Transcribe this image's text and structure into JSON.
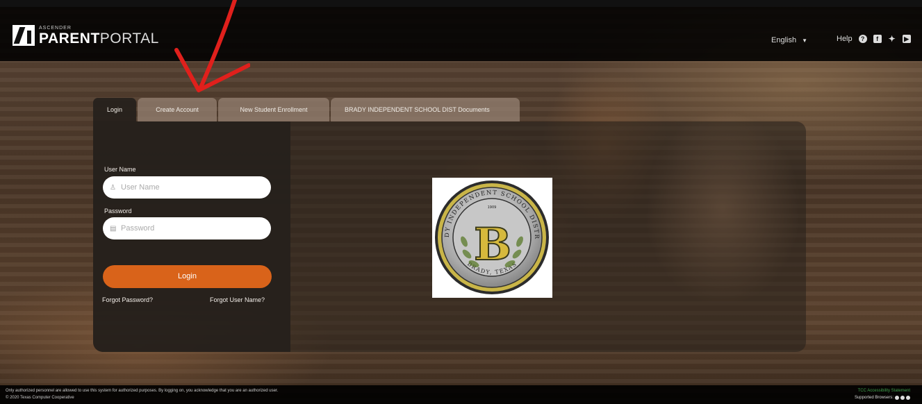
{
  "header": {
    "logo_sup": "ASCENDER",
    "logo_bold": "PARENT",
    "logo_light": "PORTAL",
    "language": "English",
    "help_label": "Help"
  },
  "tabs": [
    {
      "label": "Login"
    },
    {
      "label": "Create Account"
    },
    {
      "label": "New Student Enrollment"
    },
    {
      "label": "BRADY INDEPENDENT SCHOOL DIST Documents"
    }
  ],
  "login": {
    "username_label": "User Name",
    "username_placeholder": "User Name",
    "password_label": "Password",
    "password_placeholder": "Password",
    "login_button": "Login",
    "forgot_password": "Forgot Password?",
    "forgot_username": "Forgot User Name?"
  },
  "seal": {
    "letter": "B",
    "ring_text": "BRADY INDEPENDENT SCHOOL DISTRICT",
    "bottom_text": "BRADY, TEXAS",
    "year": "1909"
  },
  "footer": {
    "disclaimer": "Only authorized personnel are allowed to use this system for authorized purposes. By logging on, you acknowledge that you are an authorized user.",
    "copyright": "© 2020 Texas Computer Cooperative",
    "accessibility": "TCC Accessibility Statement",
    "supported_browsers": "Supported Browsers:"
  },
  "colors": {
    "accent_orange": "#d9631a",
    "annotation_red": "#e0201c",
    "accessibility_green": "#3fa34d"
  }
}
